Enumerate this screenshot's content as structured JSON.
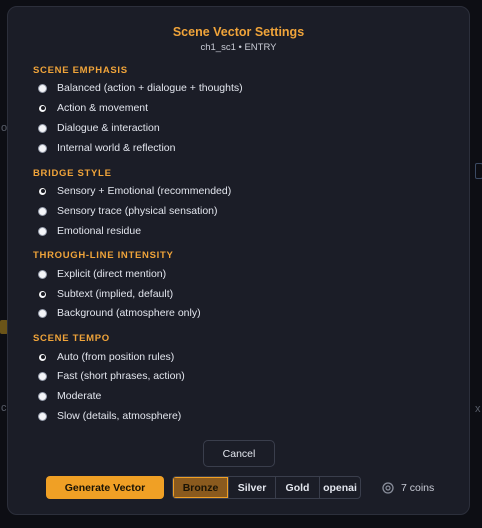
{
  "background": {
    "fragments": [
      "o",
      "x",
      "c"
    ]
  },
  "dialog": {
    "title": "Scene Vector Settings",
    "subtitle": "ch1_sc1 • ENTRY"
  },
  "sections": {
    "scene_emphasis": {
      "title": "SCENE EMPHASIS",
      "options": [
        {
          "label": "Balanced (action + dialogue + thoughts)",
          "selected": false
        },
        {
          "label": "Action & movement",
          "selected": true
        },
        {
          "label": "Dialogue & interaction",
          "selected": false
        },
        {
          "label": "Internal world & reflection",
          "selected": false
        }
      ]
    },
    "bridge_style": {
      "title": "BRIDGE STYLE",
      "options": [
        {
          "label": "Sensory + Emotional (recommended)",
          "selected": true
        },
        {
          "label": "Sensory trace (physical sensation)",
          "selected": false
        },
        {
          "label": "Emotional residue",
          "selected": false
        }
      ]
    },
    "through_line": {
      "title": "THROUGH-LINE INTENSITY",
      "options": [
        {
          "label": "Explicit (direct mention)",
          "selected": false
        },
        {
          "label": "Subtext (implied, default)",
          "selected": true
        },
        {
          "label": "Background (atmosphere only)",
          "selected": false
        }
      ]
    },
    "scene_tempo": {
      "title": "SCENE TEMPO",
      "options": [
        {
          "label": "Auto (from position rules)",
          "selected": true
        },
        {
          "label": "Fast (short phrases, action)",
          "selected": false
        },
        {
          "label": "Moderate",
          "selected": false
        },
        {
          "label": "Slow (details, atmosphere)",
          "selected": false
        }
      ]
    }
  },
  "actions": {
    "cancel_label": "Cancel",
    "generate_label": "Generate Vector",
    "tiers": [
      {
        "label": "Bronze",
        "active": true
      },
      {
        "label": "Silver",
        "active": false
      },
      {
        "label": "Gold",
        "active": false
      },
      {
        "label": "openai",
        "active": false
      }
    ],
    "coins_label": "7 coins",
    "coins_icon": "coin-icon"
  },
  "colors": {
    "accent": "#f0a43a",
    "button": "#f0a025",
    "dialog_bg": "#1b1d27",
    "page_bg": "#0d0e14"
  }
}
